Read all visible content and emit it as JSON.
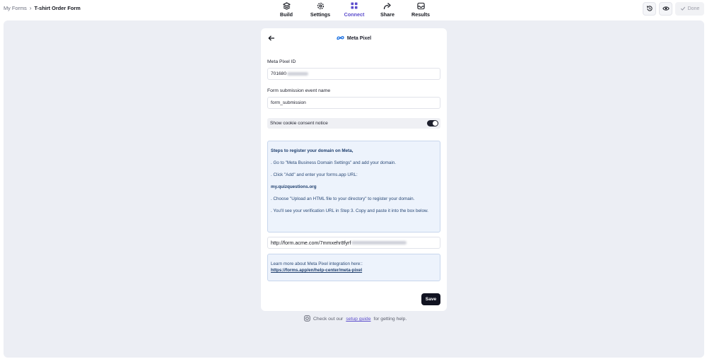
{
  "breadcrumb": {
    "root": "My Forms",
    "separator": "›",
    "current": "T-shirt Order Form"
  },
  "nav": {
    "tabs": [
      {
        "label": "Build",
        "icon": "layers-icon"
      },
      {
        "label": "Settings",
        "icon": "gear-icon"
      },
      {
        "label": "Connect",
        "icon": "grid-icon",
        "active": true
      },
      {
        "label": "Share",
        "icon": "share-arrow-icon"
      },
      {
        "label": "Results",
        "icon": "inbox-icon"
      }
    ],
    "active_color": "#5b4ccc"
  },
  "toolbar": {
    "history_icon": "history-icon",
    "preview_icon": "eye-icon",
    "done_label": "Done"
  },
  "panel": {
    "title": "Meta Pixel",
    "pixel_id": {
      "label": "Meta Pixel ID",
      "value_visible": "701680"
    },
    "event_name": {
      "label": "Form submission event name",
      "value": "form_submission"
    },
    "cookie_notice": {
      "label": "Show cookie consent notice",
      "enabled": true
    },
    "steps": {
      "heading": "Steps to register your domain on Meta,",
      "step1": ". Go to \"Meta Business Domain Settings\" and add your domain.",
      "step2": ". Click \"Add\" and enter your forms.app URL:",
      "domain": "my.quizquestions.org",
      "step3": ". Choose \"Upload an HTML file to your directory\" to register your domain.",
      "step4": ". You'll see your verification URL in Step 3. Copy and paste it into the box below."
    },
    "verification_url_visible": "http://form.acme.com/7mmxehr8fyrf",
    "learn_more": {
      "text": "Learn more about Meta Pixel integration here::",
      "link": "https://forms.app/en/help-center/meta-pixel"
    },
    "save_label": "Save"
  },
  "help": {
    "prefix": "Check out our",
    "link": "setup guide",
    "suffix": "for getting help."
  }
}
